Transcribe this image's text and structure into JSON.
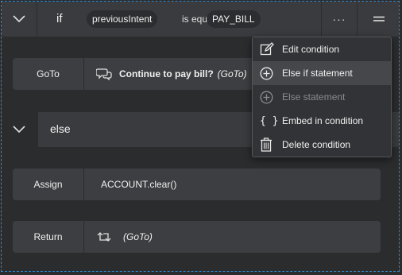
{
  "if_block": {
    "keyword": "if",
    "variable": "previousIntent",
    "operator": "is equal to",
    "value": "PAY_BILL",
    "more_label": "···"
  },
  "goto_row": {
    "label": "GoTo",
    "title": "Continue to pay bill?",
    "suffix": "(GoTo)"
  },
  "else_block": {
    "keyword": "else"
  },
  "assign_row": {
    "label": "Assign",
    "value": "ACCOUNT.clear()"
  },
  "return_row": {
    "label": "Return",
    "suffix": "(GoTo)"
  },
  "menu": {
    "items": [
      {
        "label": "Edit condition",
        "icon": "edit-icon",
        "state": "normal"
      },
      {
        "label": "Else if statement",
        "icon": "plus-circle-icon",
        "state": "hover"
      },
      {
        "label": "Else statement",
        "icon": "plus-circle-icon",
        "state": "disabled"
      },
      {
        "label": "Embed in condition",
        "icon": "braces-icon",
        "state": "normal"
      },
      {
        "label": "Delete condition",
        "icon": "trash-icon",
        "state": "normal"
      }
    ]
  },
  "colors": {
    "background": "#2b2c2e",
    "panel": "#3a3b3e",
    "selection_border": "#2f86c8",
    "menu_hover": "#46474b"
  }
}
